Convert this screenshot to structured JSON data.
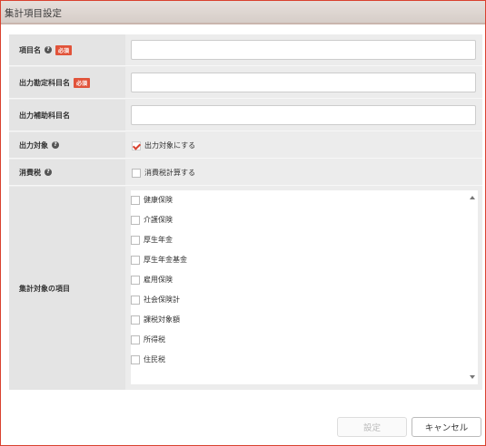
{
  "dialog": {
    "title": "集計項目設定"
  },
  "fields": {
    "item_name": {
      "label": "項目名",
      "required": "必須",
      "value": ""
    },
    "output_account": {
      "label": "出力勘定科目名",
      "required": "必須",
      "value": ""
    },
    "output_sub_account": {
      "label": "出力補助科目名",
      "value": ""
    },
    "output_target": {
      "label": "出力対象",
      "checkbox_label": "出力対象にする",
      "checked": true
    },
    "consumption_tax": {
      "label": "消費税",
      "checkbox_label": "消費税計算する",
      "checked": false
    },
    "aggregate_items": {
      "label": "集計対象の項目",
      "items": [
        "健康保険",
        "介護保険",
        "厚生年金",
        "厚生年金基金",
        "雇用保険",
        "社会保険計",
        "課税対象額",
        "所得税",
        "住民税"
      ]
    }
  },
  "buttons": {
    "set": "設定",
    "cancel": "キャンセル"
  },
  "colors": {
    "accent": "#d9412f",
    "required_badge": "#e1533a"
  },
  "icons": {
    "help": "?"
  }
}
